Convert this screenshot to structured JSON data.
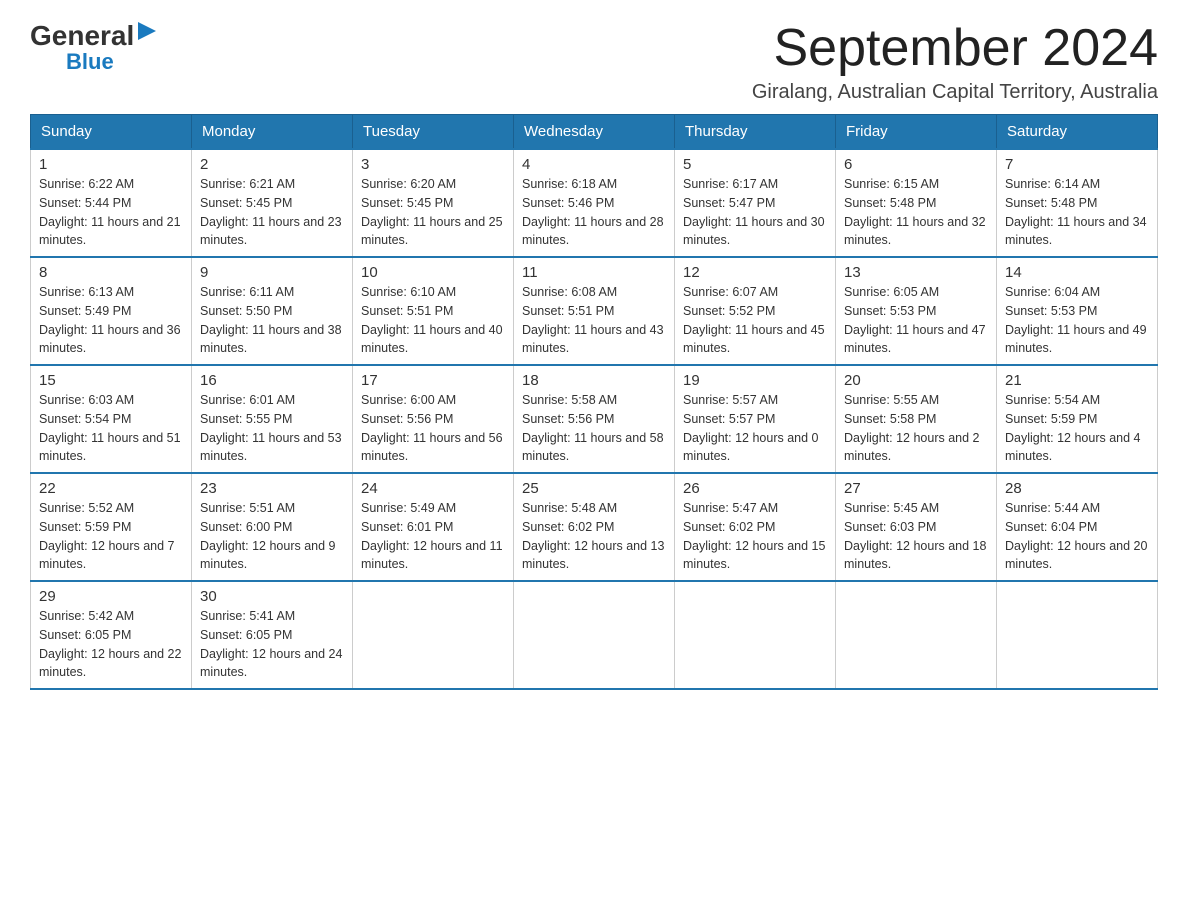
{
  "logo": {
    "general": "General",
    "blue": "Blue",
    "triangle": "▶"
  },
  "title": "September 2024",
  "location": "Giralang, Australian Capital Territory, Australia",
  "days_header": [
    "Sunday",
    "Monday",
    "Tuesday",
    "Wednesday",
    "Thursday",
    "Friday",
    "Saturday"
  ],
  "weeks": [
    [
      {
        "day": "1",
        "sunrise": "6:22 AM",
        "sunset": "5:44 PM",
        "daylight": "11 hours and 21 minutes."
      },
      {
        "day": "2",
        "sunrise": "6:21 AM",
        "sunset": "5:45 PM",
        "daylight": "11 hours and 23 minutes."
      },
      {
        "day": "3",
        "sunrise": "6:20 AM",
        "sunset": "5:45 PM",
        "daylight": "11 hours and 25 minutes."
      },
      {
        "day": "4",
        "sunrise": "6:18 AM",
        "sunset": "5:46 PM",
        "daylight": "11 hours and 28 minutes."
      },
      {
        "day": "5",
        "sunrise": "6:17 AM",
        "sunset": "5:47 PM",
        "daylight": "11 hours and 30 minutes."
      },
      {
        "day": "6",
        "sunrise": "6:15 AM",
        "sunset": "5:48 PM",
        "daylight": "11 hours and 32 minutes."
      },
      {
        "day": "7",
        "sunrise": "6:14 AM",
        "sunset": "5:48 PM",
        "daylight": "11 hours and 34 minutes."
      }
    ],
    [
      {
        "day": "8",
        "sunrise": "6:13 AM",
        "sunset": "5:49 PM",
        "daylight": "11 hours and 36 minutes."
      },
      {
        "day": "9",
        "sunrise": "6:11 AM",
        "sunset": "5:50 PM",
        "daylight": "11 hours and 38 minutes."
      },
      {
        "day": "10",
        "sunrise": "6:10 AM",
        "sunset": "5:51 PM",
        "daylight": "11 hours and 40 minutes."
      },
      {
        "day": "11",
        "sunrise": "6:08 AM",
        "sunset": "5:51 PM",
        "daylight": "11 hours and 43 minutes."
      },
      {
        "day": "12",
        "sunrise": "6:07 AM",
        "sunset": "5:52 PM",
        "daylight": "11 hours and 45 minutes."
      },
      {
        "day": "13",
        "sunrise": "6:05 AM",
        "sunset": "5:53 PM",
        "daylight": "11 hours and 47 minutes."
      },
      {
        "day": "14",
        "sunrise": "6:04 AM",
        "sunset": "5:53 PM",
        "daylight": "11 hours and 49 minutes."
      }
    ],
    [
      {
        "day": "15",
        "sunrise": "6:03 AM",
        "sunset": "5:54 PM",
        "daylight": "11 hours and 51 minutes."
      },
      {
        "day": "16",
        "sunrise": "6:01 AM",
        "sunset": "5:55 PM",
        "daylight": "11 hours and 53 minutes."
      },
      {
        "day": "17",
        "sunrise": "6:00 AM",
        "sunset": "5:56 PM",
        "daylight": "11 hours and 56 minutes."
      },
      {
        "day": "18",
        "sunrise": "5:58 AM",
        "sunset": "5:56 PM",
        "daylight": "11 hours and 58 minutes."
      },
      {
        "day": "19",
        "sunrise": "5:57 AM",
        "sunset": "5:57 PM",
        "daylight": "12 hours and 0 minutes."
      },
      {
        "day": "20",
        "sunrise": "5:55 AM",
        "sunset": "5:58 PM",
        "daylight": "12 hours and 2 minutes."
      },
      {
        "day": "21",
        "sunrise": "5:54 AM",
        "sunset": "5:59 PM",
        "daylight": "12 hours and 4 minutes."
      }
    ],
    [
      {
        "day": "22",
        "sunrise": "5:52 AM",
        "sunset": "5:59 PM",
        "daylight": "12 hours and 7 minutes."
      },
      {
        "day": "23",
        "sunrise": "5:51 AM",
        "sunset": "6:00 PM",
        "daylight": "12 hours and 9 minutes."
      },
      {
        "day": "24",
        "sunrise": "5:49 AM",
        "sunset": "6:01 PM",
        "daylight": "12 hours and 11 minutes."
      },
      {
        "day": "25",
        "sunrise": "5:48 AM",
        "sunset": "6:02 PM",
        "daylight": "12 hours and 13 minutes."
      },
      {
        "day": "26",
        "sunrise": "5:47 AM",
        "sunset": "6:02 PM",
        "daylight": "12 hours and 15 minutes."
      },
      {
        "day": "27",
        "sunrise": "5:45 AM",
        "sunset": "6:03 PM",
        "daylight": "12 hours and 18 minutes."
      },
      {
        "day": "28",
        "sunrise": "5:44 AM",
        "sunset": "6:04 PM",
        "daylight": "12 hours and 20 minutes."
      }
    ],
    [
      {
        "day": "29",
        "sunrise": "5:42 AM",
        "sunset": "6:05 PM",
        "daylight": "12 hours and 22 minutes."
      },
      {
        "day": "30",
        "sunrise": "5:41 AM",
        "sunset": "6:05 PM",
        "daylight": "12 hours and 24 minutes."
      },
      null,
      null,
      null,
      null,
      null
    ]
  ],
  "labels": {
    "sunrise": "Sunrise:",
    "sunset": "Sunset:",
    "daylight": "Daylight:"
  }
}
